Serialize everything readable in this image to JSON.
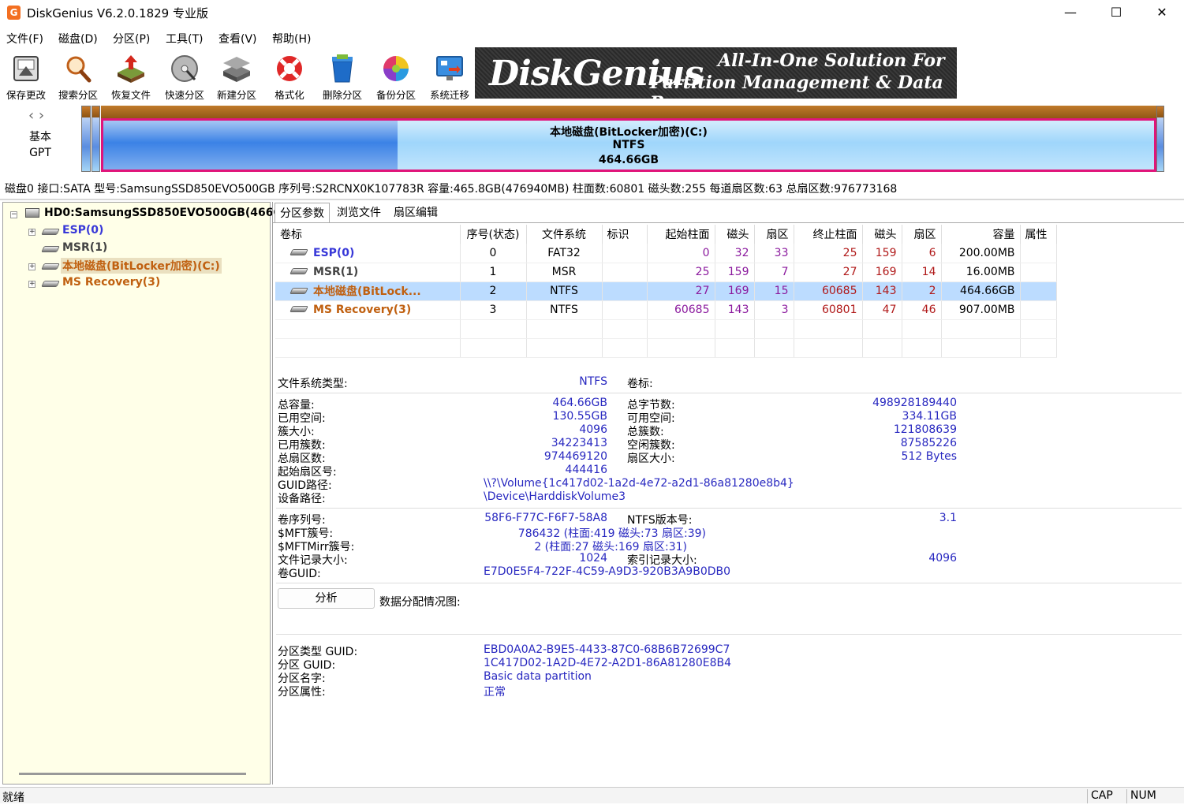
{
  "window": {
    "title": "DiskGenius V6.2.0.1829 专业版",
    "minimize": "—",
    "maximize": "☐",
    "close": "✕"
  },
  "menu": [
    "文件(F)",
    "磁盘(D)",
    "分区(P)",
    "工具(T)",
    "查看(V)",
    "帮助(H)"
  ],
  "toolbar": [
    {
      "label": "保存更改",
      "icon": "save-icon"
    },
    {
      "label": "搜索分区",
      "icon": "magnifier-icon"
    },
    {
      "label": "恢复文件",
      "icon": "recover-icon"
    },
    {
      "label": "快速分区",
      "icon": "disk-icon"
    },
    {
      "label": "新建分区",
      "icon": "layers-icon"
    },
    {
      "label": "格式化",
      "icon": "lifebuoy-icon"
    },
    {
      "label": "删除分区",
      "icon": "trash-icon"
    },
    {
      "label": "备份分区",
      "icon": "pie-icon"
    },
    {
      "label": "系统迁移",
      "icon": "monitor-icon"
    }
  ],
  "banner": {
    "brand": "DiskGenius",
    "line1": "All-In-One Solution For",
    "line2": "Partition Management & Data Recovery"
  },
  "diskmap": {
    "type_line1": "基本",
    "type_line2": "GPT",
    "part_name": "本地磁盘(BitLocker加密)(C:)",
    "part_fs": "NTFS",
    "part_size": "464.66GB"
  },
  "disk_info": "磁盘0 接口:SATA  型号:SamsungSSD850EVO500GB  序列号:S2RCNX0K107783R  容量:465.8GB(476940MB)  柱面数:60801  磁头数:255  每道扇区数:63  总扇区数:976773168",
  "tree": {
    "disk": "HD0:SamsungSSD850EVO500GB(466G",
    "items": [
      "ESP(0)",
      "MSR(1)",
      "本地磁盘(BitLocker加密)(C:)",
      "MS Recovery(3)"
    ]
  },
  "tabs": [
    "分区参数",
    "浏览文件",
    "扇区编辑"
  ],
  "table": {
    "headers": [
      "卷标",
      "序号(状态)",
      "文件系统",
      "标识",
      "起始柱面",
      "磁头",
      "扇区",
      "终止柱面",
      "磁头",
      "扇区",
      "容量",
      "属性"
    ],
    "rows": [
      [
        "ESP(0)",
        "0",
        "FAT32",
        "",
        "0",
        "32",
        "33",
        "25",
        "159",
        "6",
        "200.00MB",
        ""
      ],
      [
        "MSR(1)",
        "1",
        "MSR",
        "",
        "25",
        "159",
        "7",
        "27",
        "169",
        "14",
        "16.00MB",
        ""
      ],
      [
        "本地磁盘(BitLock...",
        "2",
        "NTFS",
        "",
        "27",
        "169",
        "15",
        "60685",
        "143",
        "2",
        "464.66GB",
        ""
      ],
      [
        "MS Recovery(3)",
        "3",
        "NTFS",
        "",
        "60685",
        "143",
        "3",
        "60801",
        "47",
        "46",
        "907.00MB",
        ""
      ]
    ]
  },
  "details": {
    "fs_type_label": "文件系统类型:",
    "fs_type": "NTFS",
    "vol_label_label": "卷标:",
    "total_label": "总容量:",
    "total": "464.66GB",
    "total_bytes_label": "总字节数:",
    "total_bytes": "498928189440",
    "used_label": "已用空间:",
    "used": "130.55GB",
    "free_label": "可用空间:",
    "free": "334.11GB",
    "cluster_label": "簇大小:",
    "cluster": "4096",
    "clusters_label": "总簇数:",
    "clusters": "121808639",
    "used_clusters_label": "已用簇数:",
    "used_clusters": "34223413",
    "free_clusters_label": "空闲簇数:",
    "free_clusters": "87585226",
    "sectors_label": "总扇区数:",
    "sectors": "974469120",
    "sector_size_label": "扇区大小:",
    "sector_size": "512 Bytes",
    "start_sector_label": "起始扇区号:",
    "start_sector": "444416",
    "guid_path_label": "GUID路径:",
    "guid_path": "\\\\?\\Volume{1c417d02-1a2d-4e72-a2d1-86a81280e8b4}",
    "device_path_label": "设备路径:",
    "device_path": "\\Device\\HarddiskVolume3",
    "serial_label": "卷序列号:",
    "serial": "58F6-F77C-F6F7-58A8",
    "ntfs_ver_label": "NTFS版本号:",
    "ntfs_ver": "3.1",
    "mft_label": "$MFT簇号:",
    "mft": "786432 (柱面:419 磁头:73 扇区:39)",
    "mftmirr_label": "$MFTMirr簇号:",
    "mftmirr": "2 (柱面:27 磁头:169 扇区:31)",
    "record_label": "文件记录大小:",
    "record": "1024",
    "index_label": "索引记录大小:",
    "index": "4096",
    "volguid_label": "卷GUID:",
    "volguid": "E7D0E5F4-722F-4C59-A9D3-920B3A9B0DB0",
    "analyze": "分析",
    "alloc_label": "数据分配情况图:",
    "ptype_label": "分区类型 GUID:",
    "ptype": "EBD0A0A2-B9E5-4433-87C0-68B6B72699C7",
    "pguid_label": "分区 GUID:",
    "pguid": "1C417D02-1A2D-4E72-A2D1-86A81280E8B4",
    "pname_label": "分区名字:",
    "pname": "Basic data partition",
    "pattr_label": "分区属性:",
    "pattr": "正常"
  },
  "status": {
    "text": "就绪",
    "cap": "CAP",
    "num": "NUM"
  }
}
